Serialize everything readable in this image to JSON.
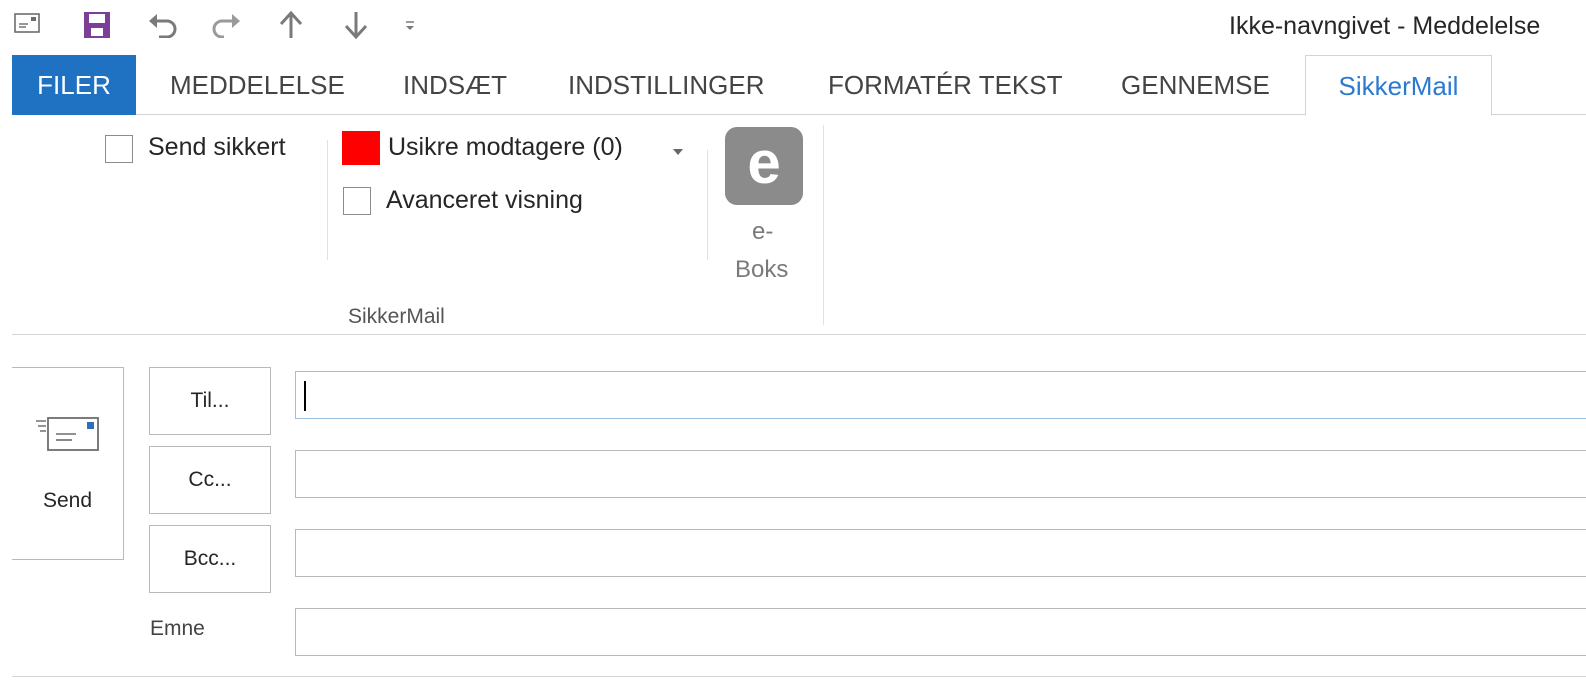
{
  "window": {
    "title": "Ikke-navngivet - Meddelelse"
  },
  "quick_access": {
    "icons": [
      "message-icon",
      "save-icon",
      "undo-icon",
      "redo-icon",
      "up-arrow-icon",
      "down-arrow-icon",
      "customize-dropdown-icon"
    ]
  },
  "tabs": [
    {
      "label": "FILER"
    },
    {
      "label": "MEDDELELSE"
    },
    {
      "label": "INDSÆT"
    },
    {
      "label": "INDSTILLINGER"
    },
    {
      "label": "FORMATÉR TEKST"
    },
    {
      "label": "GENNEMSE"
    },
    {
      "label": "SikkerMail"
    }
  ],
  "active_tab": "SikkerMail",
  "ribbon": {
    "send_secure_label": "Send sikkert",
    "send_secure_checked": false,
    "unsafe_recipients_label": "Usikre modtagere (0)",
    "unsafe_status_color": "#ff0000",
    "advanced_view_label": "Avanceret visning",
    "advanced_view_checked": false,
    "eboks_logo_letter": "e",
    "eboks_label_line1": "e-",
    "eboks_label_line2": "Boks",
    "group_label": "SikkerMail"
  },
  "compose": {
    "send_label": "Send",
    "to_button": "Til...",
    "cc_button": "Cc...",
    "bcc_button": "Bcc...",
    "subject_label": "Emne",
    "to_value": "",
    "cc_value": "",
    "bcc_value": "",
    "subject_value": ""
  },
  "colors": {
    "accent": "#1e72c1",
    "active_tab_text": "#2a7ad0",
    "save_icon": "#7b3f98"
  }
}
